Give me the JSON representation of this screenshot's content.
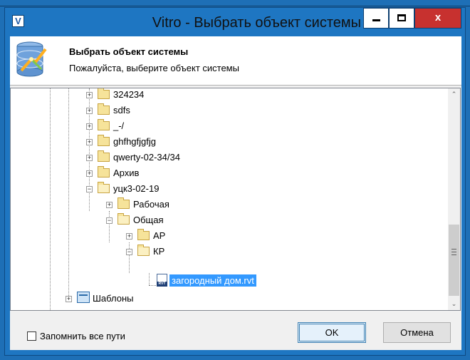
{
  "window": {
    "app_icon_letter": "V",
    "title": "Vitro - Выбрать объект системы",
    "close_glyph": "x"
  },
  "header": {
    "title": "Выбрать объект системы",
    "subtitle": "Пожалуйста, выберите объект системы",
    "icon": "database-wizard-icon"
  },
  "tree": {
    "nodes": [
      {
        "label": "324234",
        "expander": "+",
        "icon": "folder-icon"
      },
      {
        "label": "sdfs",
        "expander": "+",
        "icon": "folder-icon"
      },
      {
        "label": "_-/",
        "expander": "+",
        "icon": "folder-icon"
      },
      {
        "label": "ghfhgfjgfjg",
        "expander": "+",
        "icon": "folder-icon"
      },
      {
        "label": "qwerty-02-34/34",
        "expander": "+",
        "icon": "folder-icon"
      },
      {
        "label": "Архив",
        "expander": "+",
        "icon": "folder-icon"
      },
      {
        "label": "уцк3-02-19",
        "expander": "−",
        "icon": "folder-open-icon"
      },
      {
        "label": "Рабочая",
        "expander": "+",
        "icon": "folder-icon"
      },
      {
        "label": "Общая",
        "expander": "−",
        "icon": "folder-open-icon"
      },
      {
        "label": "АР",
        "expander": "+",
        "icon": "folder-icon"
      },
      {
        "label": "КР",
        "expander": "−",
        "icon": "folder-open-icon"
      },
      {
        "label": "загородный дом.rvt",
        "selected": true,
        "icon": "rvt-file-icon",
        "icon_text": "RVT"
      },
      {
        "label": "Шаблоны",
        "expander": "+",
        "icon": "templates-icon"
      }
    ],
    "scroll_up": "⌃",
    "scroll_down": "⌄"
  },
  "footer": {
    "remember_label": "Запомнить все пути",
    "remember_checked": false,
    "ok_label": "OK",
    "cancel_label": "Отмена"
  },
  "colors": {
    "window_frame": "#1e76c2",
    "close_button": "#c7312f",
    "selection": "#3399ff"
  }
}
